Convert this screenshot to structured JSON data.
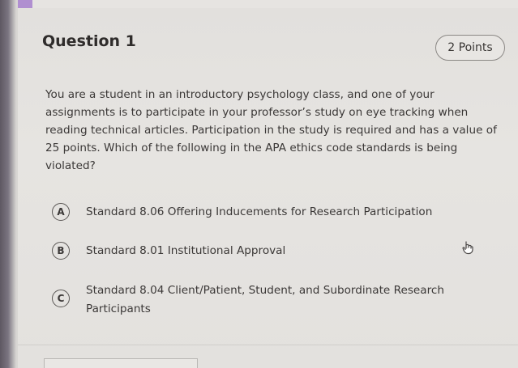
{
  "question": {
    "title": "Question 1",
    "points": "2 Points",
    "text": "You are a student in an introductory psychology class, and one of your assignments is to participate in your professor’s study on eye tracking when reading technical articles. Participation in the study is required and has a value of 25 points. Which of the following in the APA ethics code standards is being violated?"
  },
  "options": [
    {
      "letter": "A",
      "text": "Standard 8.06 Offering Inducements for Research Participation"
    },
    {
      "letter": "B",
      "text": "Standard 8.01 Institutional Approval"
    },
    {
      "letter": "C",
      "text": "Standard 8.04 Client/Patient, Student, and Subordinate Research Participants"
    }
  ],
  "icons": {
    "cursor": "hand-pointer-icon"
  }
}
